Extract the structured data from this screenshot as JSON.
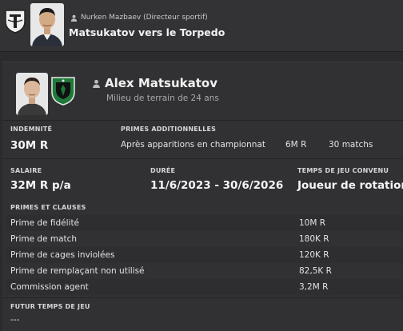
{
  "header": {
    "subtitle": "Nurken Mazbaev  (Directeur sportif)",
    "title": "Matsukatov vers le Torpedo"
  },
  "player": {
    "name": "Alex Matsukatov",
    "role": "Milieu de terrain de 24 ans"
  },
  "fee": {
    "label": "INDEMNITÉ",
    "value": "30M R"
  },
  "bonuses": {
    "label": "PRIMES ADDITIONNELLES",
    "item": "Après apparitions en championnat",
    "amount": "6M R",
    "count": "30 matchs"
  },
  "contract": {
    "salary_label": "SALAIRE",
    "salary": "32M R p/a",
    "duration_label": "DURÉE",
    "duration": "11/6/2023 - 30/6/2026",
    "playing_time_label": "TEMPS DE JEU CONVENU",
    "playing_time": "Joueur de rotation"
  },
  "clauses": {
    "label": "PRIMES ET CLAUSES",
    "rows": [
      {
        "name": "Prime de fidélité",
        "value": "10M R"
      },
      {
        "name": "Prime de match",
        "value": "180K R"
      },
      {
        "name": "Prime de cages inviolées",
        "value": "120K R"
      },
      {
        "name": "Prime de remplaçant non utilisé",
        "value": "82,5K R"
      },
      {
        "name": "Commission agent",
        "value": "3,2M R"
      }
    ]
  },
  "future": {
    "label": "FUTUR TEMPS DE JEU",
    "value": "---"
  },
  "colors": {
    "background": "#2b2b2d",
    "badge_green": "#1f7a3a"
  }
}
